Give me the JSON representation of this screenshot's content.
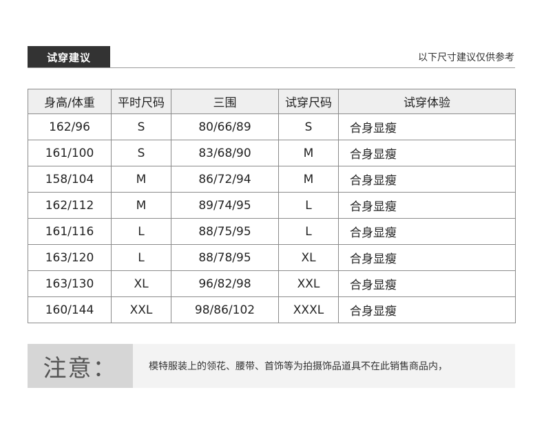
{
  "header": {
    "title": "试穿建议",
    "note": "以下尺寸建议仅供参考"
  },
  "table": {
    "columns": [
      "身高/体重",
      "平时尺码",
      "三围",
      "试穿尺码",
      "试穿体验"
    ],
    "rows": [
      [
        "162/96",
        "S",
        "80/66/89",
        "S",
        "合身显瘦"
      ],
      [
        "161/100",
        "S",
        "83/68/90",
        "M",
        "合身显瘦"
      ],
      [
        "158/104",
        "M",
        "86/72/94",
        "M",
        "合身显瘦"
      ],
      [
        "162/112",
        "M",
        "89/74/95",
        "L",
        "合身显瘦"
      ],
      [
        "161/116",
        "L",
        "88/75/95",
        "L",
        "合身显瘦"
      ],
      [
        "163/120",
        "L",
        "88/78/95",
        "XL",
        "合身显瘦"
      ],
      [
        "163/130",
        "XL",
        "96/82/98",
        "XXL",
        "合身显瘦"
      ],
      [
        "160/144",
        "XXL",
        "98/86/102",
        "XXXL",
        "合身显瘦"
      ]
    ]
  },
  "notice": {
    "label": "注意：",
    "text": "模特服装上的领花、腰带、首饰等为拍摄饰品道具不在此销售商品内，"
  }
}
